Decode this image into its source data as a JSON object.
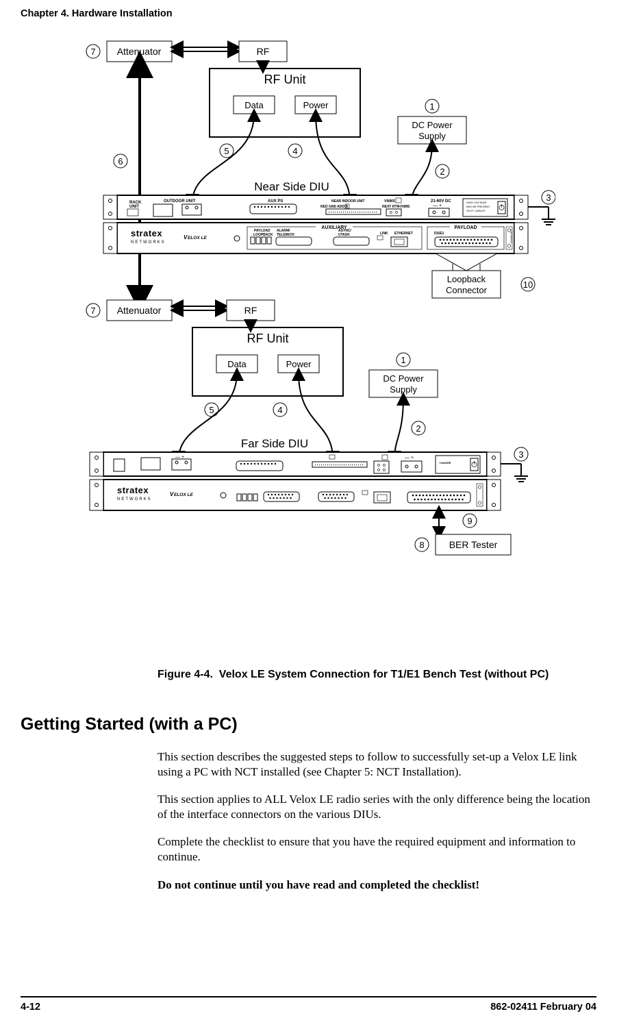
{
  "chapter_header": "Chapter 4. Hardware Installation",
  "figure": {
    "caption_label": "Figure 4-4.",
    "caption_text": "Velox LE System Connection for T1/E1 Bench Test (without PC)",
    "labels": {
      "attenuator": "Attenuator",
      "rf": "RF",
      "rf_unit": "RF Unit",
      "data": "Data",
      "power": "Power",
      "dc_power_supply": "DC Power Supply",
      "near_side": "Near Side DIU",
      "far_side": "Far Side DIU",
      "loopback_connector": "Loopback Connector",
      "ber_tester": "BER Tester",
      "brand": "stratex",
      "brand_sub": "NETWORKS",
      "model": "VELOX LE",
      "auxiliary": "AUXILIARY",
      "payload": "PAYLOAD",
      "rack_unit": "RACK UNIT",
      "outdoor_unit": "OUTDOOR UNIT",
      "aux_ps": "AUX PS",
      "near_indoor_unit": "NEAR INDOOR UNIT",
      "dc_range": "21-60V DC",
      "vnms": "VNMS"
    },
    "callouts": [
      "1",
      "2",
      "3",
      "4",
      "5",
      "6",
      "7",
      "8",
      "9",
      "10"
    ]
  },
  "section_title": "Getting Started (with a PC)",
  "paragraphs": {
    "p1": "This section describes the suggested steps to follow to successfully set-up a Velox LE link using a PC with NCT installed (see Chapter 5: NCT Installation).",
    "p2": "This section applies to ALL Velox LE radio series with the only difference being the location of the interface connectors on the various DIUs.",
    "p3": "Complete the checklist to ensure that you have the required equipment and information to continue.",
    "p4": "Do not continue until you have read and completed the checklist!"
  },
  "footer": {
    "page": "4-12",
    "docid": "862-02411 February 04"
  }
}
